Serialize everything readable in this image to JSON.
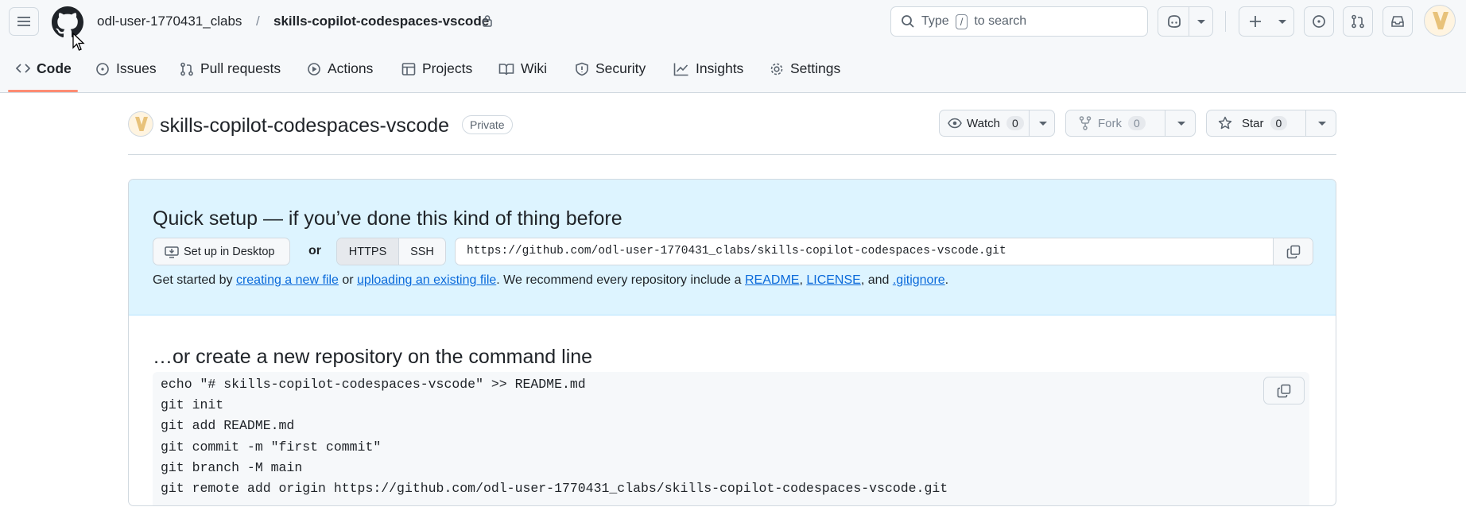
{
  "header": {
    "owner": "odl-user-1770431_clabs",
    "separator": "/",
    "repo": "skills-copilot-codespaces-vscode",
    "search": {
      "prefix": "Type",
      "key": "/",
      "suffix": "to search"
    }
  },
  "tabs": [
    {
      "label": "Code",
      "icon": "code-icon"
    },
    {
      "label": "Issues",
      "icon": "issue-icon"
    },
    {
      "label": "Pull requests",
      "icon": "pull-request-icon"
    },
    {
      "label": "Actions",
      "icon": "play-icon"
    },
    {
      "label": "Projects",
      "icon": "table-icon"
    },
    {
      "label": "Wiki",
      "icon": "book-icon"
    },
    {
      "label": "Security",
      "icon": "shield-icon"
    },
    {
      "label": "Insights",
      "icon": "graph-icon"
    },
    {
      "label": "Settings",
      "icon": "gear-icon"
    }
  ],
  "repo_header": {
    "title": "skills-copilot-codespaces-vscode",
    "visibility": "Private",
    "watch": {
      "label": "Watch",
      "count": "0"
    },
    "fork": {
      "label": "Fork",
      "count": "0"
    },
    "star": {
      "label": "Star",
      "count": "0"
    }
  },
  "quick_setup": {
    "heading": "Quick setup — if you’ve done this kind of thing before",
    "desktop_button": "Set up in Desktop",
    "or": "or",
    "protocols": [
      "HTTPS",
      "SSH"
    ],
    "selected_protocol": "HTTPS",
    "clone_url": "https://github.com/odl-user-1770431_clabs/skills-copilot-codespaces-vscode.git",
    "help": {
      "t1": "Get started by ",
      "link1": "creating a new file",
      "t2": " or ",
      "link2": "uploading an existing file",
      "t3": ". We recommend every repository include a ",
      "link3": "README",
      "t4": ", ",
      "link4": "LICENSE",
      "t5": ", and ",
      "link5": ".gitignore",
      "t6": "."
    }
  },
  "command_line": {
    "heading": "…or create a new repository on the command line",
    "lines": [
      "echo \"# skills-copilot-codespaces-vscode\" >> README.md",
      "git init",
      "git add README.md",
      "git commit -m \"first commit\"",
      "git branch -M main",
      "git remote add origin https://github.com/odl-user-1770431_clabs/skills-copilot-codespaces-vscode.git"
    ]
  },
  "colors": {
    "accent": "#0969da",
    "tab_underline": "#fd8c73",
    "setup_bg": "#ddf4ff"
  }
}
